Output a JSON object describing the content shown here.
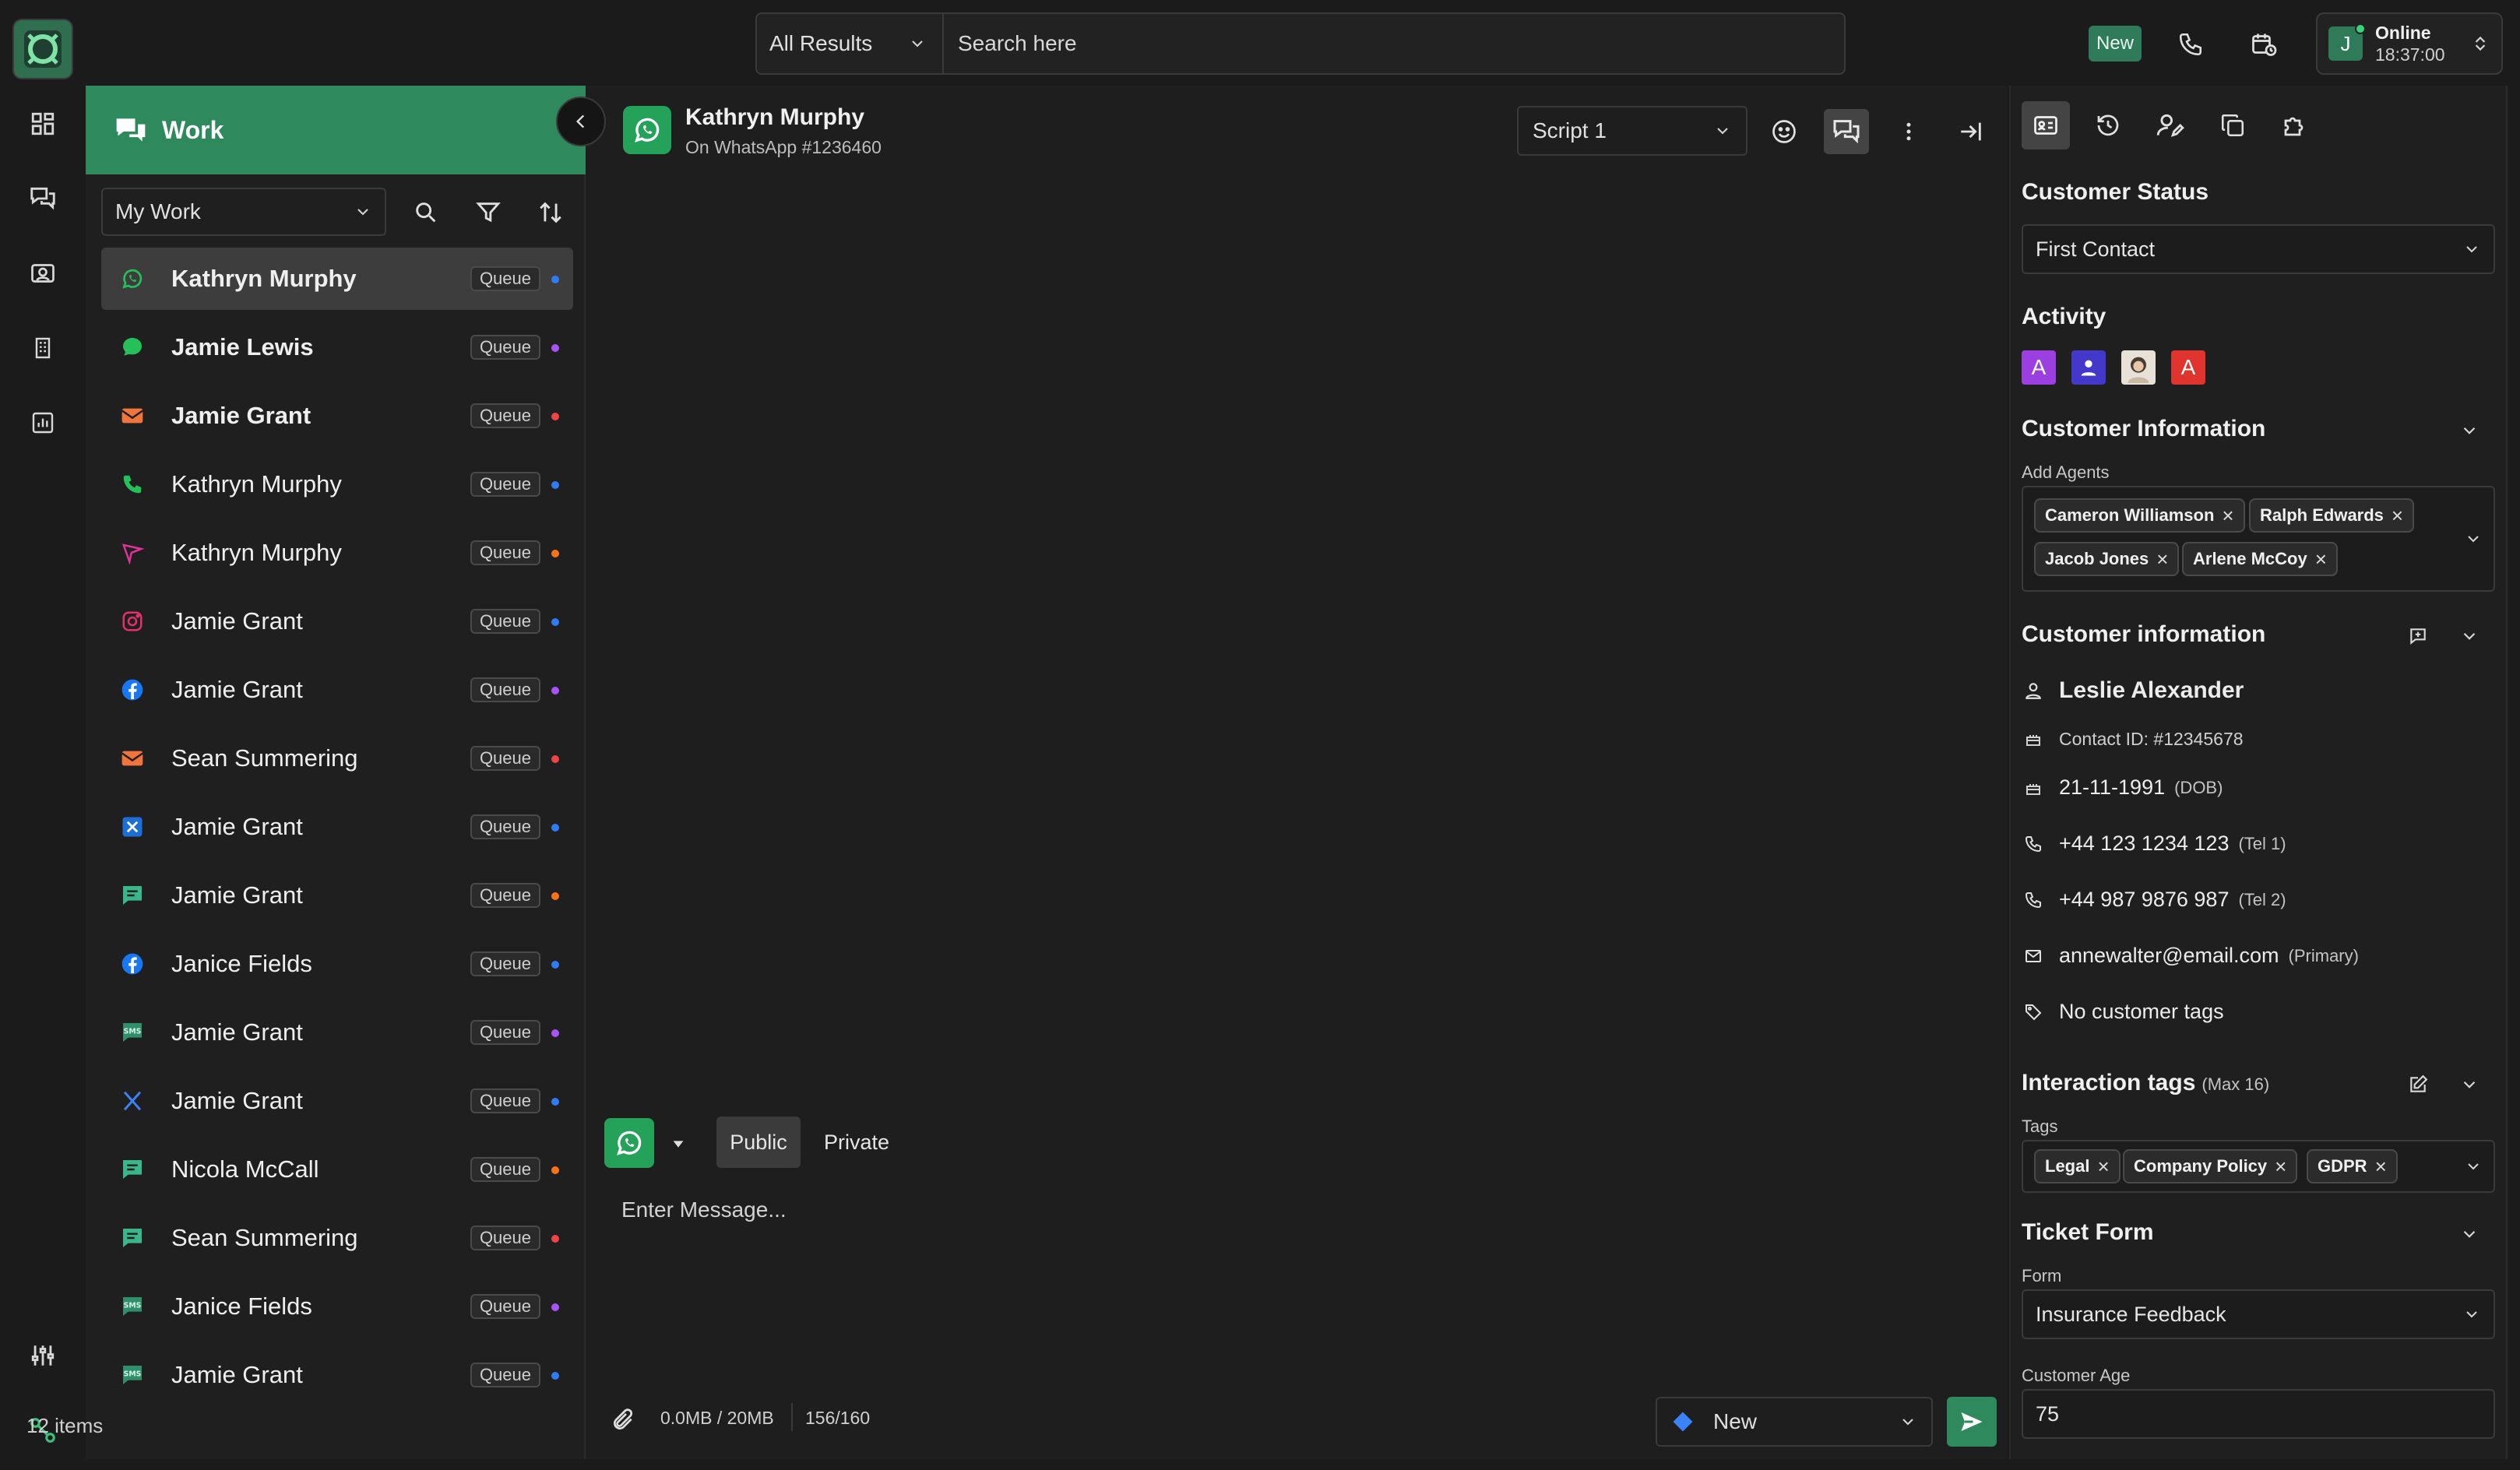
{
  "topbar": {
    "search_scope": "All Results",
    "search_placeholder": "Search here",
    "new_badge": "New",
    "status_label": "Online",
    "status_time": "18:37:00",
    "avatar_initial": "J"
  },
  "work": {
    "title": "Work",
    "filter_select": "My Work",
    "count_label": "12 items",
    "items": [
      {
        "name": "Kathryn Murphy",
        "channel": "whatsapp-icon",
        "badge": "Queue",
        "dot": "#2f7bf6",
        "selected": true,
        "bold": true
      },
      {
        "name": "Jamie Lewis",
        "channel": "chat-bubble-icon",
        "badge": "Queue",
        "dot": "#a855f7",
        "bold": true
      },
      {
        "name": "Jamie Grant",
        "channel": "email-icon",
        "badge": "Queue",
        "dot": "#ef4444",
        "bold": true
      },
      {
        "name": "Kathryn Murphy",
        "channel": "phone-icon",
        "badge": "Queue",
        "dot": "#2f7bf6"
      },
      {
        "name": "Kathryn Murphy",
        "channel": "send-icon",
        "badge": "Queue",
        "dot": "#f97316"
      },
      {
        "name": "Jamie Grant",
        "channel": "instagram-icon",
        "badge": "Queue",
        "dot": "#2f7bf6"
      },
      {
        "name": "Jamie Grant",
        "channel": "facebook-icon",
        "badge": "Queue",
        "dot": "#a855f7"
      },
      {
        "name": "Sean Summering",
        "channel": "email-icon",
        "badge": "Queue",
        "dot": "#ef4444"
      },
      {
        "name": "Jamie Grant",
        "channel": "x-square-icon",
        "badge": "Queue",
        "dot": "#2f7bf6"
      },
      {
        "name": "Jamie Grant",
        "channel": "message-square-icon",
        "badge": "Queue",
        "dot": "#f97316"
      },
      {
        "name": "Janice Fields",
        "channel": "facebook-icon",
        "badge": "Queue",
        "dot": "#2f7bf6"
      },
      {
        "name": "Jamie Grant",
        "channel": "sms-icon",
        "badge": "Queue",
        "dot": "#a855f7"
      },
      {
        "name": "Jamie Grant",
        "channel": "x-icon",
        "badge": "Queue",
        "dot": "#2f7bf6"
      },
      {
        "name": "Nicola McCall",
        "channel": "message-square-icon",
        "badge": "Queue",
        "dot": "#f97316"
      },
      {
        "name": "Sean Summering",
        "channel": "message-square-icon",
        "badge": "Queue",
        "dot": "#ef4444"
      },
      {
        "name": "Janice Fields",
        "channel": "sms-icon",
        "badge": "Queue",
        "dot": "#a855f7"
      },
      {
        "name": "Jamie Grant",
        "channel": "sms-icon",
        "badge": "Queue",
        "dot": "#2f7bf6"
      }
    ]
  },
  "chat": {
    "contact_name": "Kathryn Murphy",
    "contact_sub": "On WhatsApp #1236460",
    "script_select": "Script 1",
    "mode_public": "Public",
    "mode_private": "Private",
    "message_placeholder": "Enter Message...",
    "attachment_size": "0.0MB / 20MB",
    "char_count": "156/160",
    "status_select": "New"
  },
  "right": {
    "customer_status": {
      "title": "Customer Status",
      "value": "First Contact"
    },
    "activity": {
      "title": "Activity",
      "avatars": [
        "A",
        "",
        "",
        "A"
      ]
    },
    "customer_info_agents": {
      "title": "Customer Information",
      "label": "Add Agents",
      "agents": [
        "Cameron Williamson",
        "Ralph Edwards",
        "Jacob Jones",
        "Arlene McCoy"
      ]
    },
    "customer_info": {
      "title": "Customer information",
      "name": "Leslie Alexander",
      "contact_id": "Contact ID: #12345678",
      "dob": "21-11-1991",
      "dob_note": "(DOB)",
      "tel1": "+44 123 1234 123",
      "tel1_note": "(Tel 1)",
      "tel2": "+44 987 9876 987",
      "tel2_note": "(Tel 2)",
      "email": "annewalter@email.com",
      "email_note": "(Primary)",
      "tags_text": "No customer tags"
    },
    "interaction_tags": {
      "title": "Interaction tags",
      "note": "(Max 16)",
      "label": "Tags",
      "tags": [
        "Legal",
        "Company Policy",
        "GDPR"
      ]
    },
    "ticket_form": {
      "title": "Ticket Form",
      "form_label": "Form",
      "form_value": "Insurance Feedback",
      "age_label": "Customer Age",
      "age_value": "75"
    }
  },
  "colors": {
    "accent_green": "#2e8a5c",
    "whatsapp_green": "#25a25a",
    "activity_purple": "#9b3fe0",
    "activity_blue": "#4338ca",
    "activity_red": "#e0342f"
  }
}
